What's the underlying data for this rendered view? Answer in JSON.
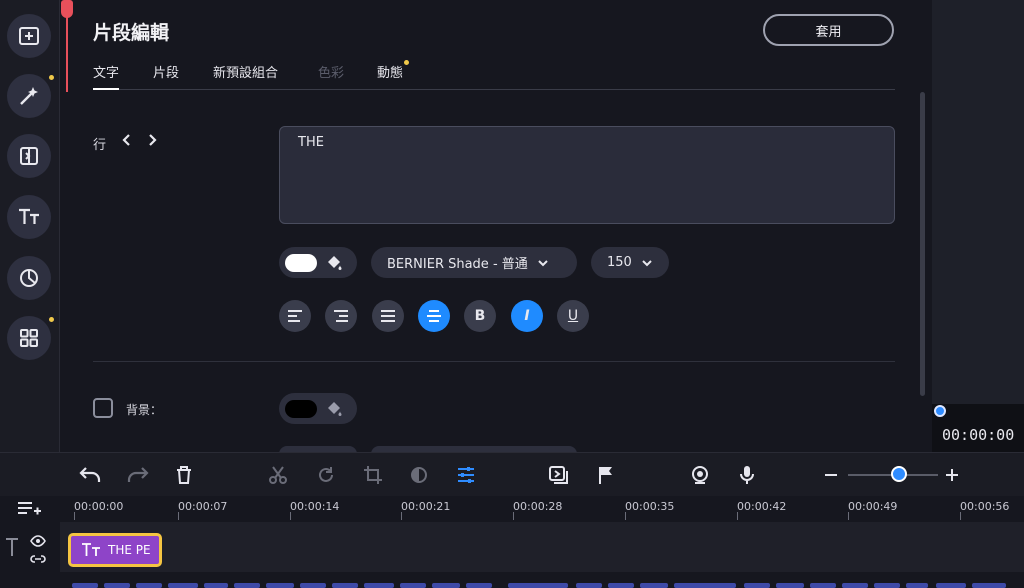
{
  "editor": {
    "title": "片段編輯",
    "apply_label": "套用",
    "tabs": [
      {
        "label": "文字",
        "active": true
      },
      {
        "label": "片段"
      },
      {
        "label": "新預設組合"
      },
      {
        "label": "色彩",
        "disabled": true
      },
      {
        "label": "動態",
        "badge": true
      }
    ],
    "line_label": "行",
    "text_value": "THE",
    "font_name": "BERNIER Shade - 普通",
    "font_size": "150",
    "background_label": "背景："
  },
  "formatting": [
    "align-left-icon",
    "align-right-icon",
    "justify-icon",
    "align-center-icon",
    "bold-icon",
    "italic-icon",
    "underline-icon"
  ],
  "preview": {
    "timecode": "00:00:00"
  },
  "timeline": {
    "ticks": [
      "00:00:00",
      "00:00:07",
      "00:00:14",
      "00:00:21",
      "00:00:28",
      "00:00:35",
      "00:00:42",
      "00:00:49",
      "00:00:56"
    ],
    "clip_label": "THE PE"
  },
  "colors": {
    "accent": "#1f8bff",
    "clip": "#8e44c8",
    "clip_border": "#f5c542",
    "playhead": "#e8505b",
    "badge": "#f0c94a"
  }
}
